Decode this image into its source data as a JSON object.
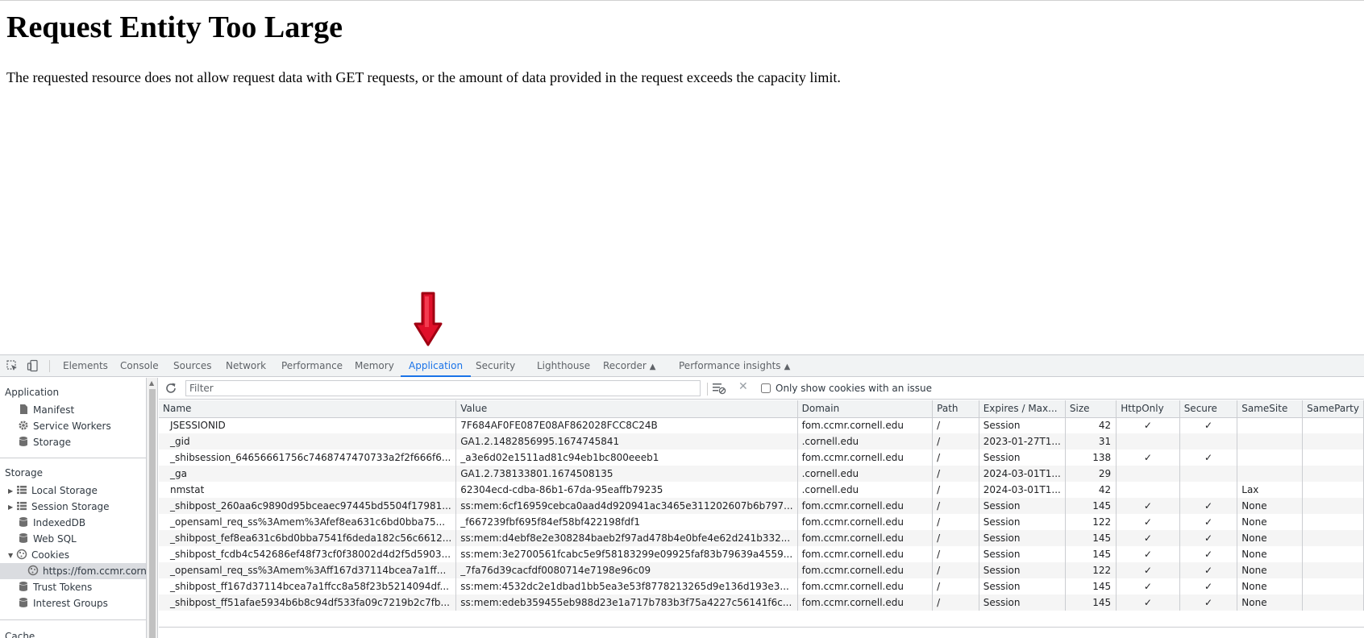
{
  "page": {
    "title": "Request Entity Too Large",
    "message": "The requested resource does not allow request data with GET requests, or the amount of data provided in the request exceeds the capacity limit."
  },
  "devtools": {
    "tabs": [
      {
        "label": "Elements",
        "active": false
      },
      {
        "label": "Console",
        "active": false
      },
      {
        "label": "Sources",
        "active": false
      },
      {
        "label": "Network",
        "active": false
      },
      {
        "label": "Performance",
        "active": false
      },
      {
        "label": "Memory",
        "active": false
      },
      {
        "label": "Application",
        "active": true
      },
      {
        "label": "Security",
        "active": false
      },
      {
        "label": "Lighthouse",
        "active": false
      },
      {
        "label": "Recorder",
        "active": false
      },
      {
        "label": "Performance insights",
        "active": false
      }
    ],
    "sidebar": {
      "application_header": "Application",
      "application_items": [
        {
          "label": "Manifest",
          "icon": "document-icon"
        },
        {
          "label": "Service Workers",
          "icon": "gear-icon"
        },
        {
          "label": "Storage",
          "icon": "database-icon"
        }
      ],
      "storage_header": "Storage",
      "storage_items": [
        {
          "label": "Local Storage",
          "icon": "grid-icon"
        },
        {
          "label": "Session Storage",
          "icon": "grid-icon"
        },
        {
          "label": "IndexedDB",
          "icon": "database-icon"
        },
        {
          "label": "Web SQL",
          "icon": "database-icon"
        },
        {
          "label": "Cookies",
          "icon": "cookie-icon"
        },
        {
          "label": "https://fom.ccmr.cornell.edu",
          "icon": "cookie-icon"
        },
        {
          "label": "Trust Tokens",
          "icon": "database-icon"
        },
        {
          "label": "Interest Groups",
          "icon": "database-icon"
        }
      ],
      "next_header": "Cache"
    },
    "toolbar": {
      "filter_placeholder": "Filter",
      "only_issues_label": "Only show cookies with an issue"
    },
    "table": {
      "columns": [
        "Name",
        "Value",
        "Domain",
        "Path",
        "Expires / Max...",
        "Size",
        "HttpOnly",
        "Secure",
        "SameSite",
        "SameParty"
      ],
      "rows": [
        [
          "JSESSIONID",
          "7F684AF0FE087E08AF862028FCC8C24B",
          "fom.ccmr.cornell.edu",
          "/",
          "Session",
          "42",
          "✓",
          "✓",
          "",
          ""
        ],
        [
          "_gid",
          "GA1.2.1482856995.1674745841",
          ".cornell.edu",
          "/",
          "2023-01-27T1...",
          "31",
          "",
          "",
          "",
          ""
        ],
        [
          "_shibsession_64656661756c7468747470733a2f2f666f6...",
          "_a3e6d02e1511ad81c94eb1bc800eeeb1",
          "fom.ccmr.cornell.edu",
          "/",
          "Session",
          "138",
          "✓",
          "✓",
          "",
          ""
        ],
        [
          "_ga",
          "GA1.2.738133801.1674508135",
          ".cornell.edu",
          "/",
          "2024-03-01T1...",
          "29",
          "",
          "",
          "",
          ""
        ],
        [
          "nmstat",
          "62304ecd-cdba-86b1-67da-95eaffb79235",
          ".cornell.edu",
          "/",
          "2024-03-01T1...",
          "42",
          "",
          "",
          "Lax",
          ""
        ],
        [
          "_shibpost_260aa6c9890d95bceaec97445bd5504f17981...",
          "ss:mem:6cf16959cebca0aad4d920941ac3465e311202607b6b797...",
          "fom.ccmr.cornell.edu",
          "/",
          "Session",
          "145",
          "✓",
          "✓",
          "None",
          ""
        ],
        [
          "_opensaml_req_ss%3Amem%3Afef8ea631c6bd0bba75...",
          "_f667239fbf695f84ef58bf422198fdf1",
          "fom.ccmr.cornell.edu",
          "/",
          "Session",
          "122",
          "✓",
          "✓",
          "None",
          ""
        ],
        [
          "_shibpost_fef8ea631c6bd0bba7541f6deda182c56c6612...",
          "ss:mem:d4ebf8e2e308284baeb2f97ad478b4e0bfe4e62d241b332...",
          "fom.ccmr.cornell.edu",
          "/",
          "Session",
          "145",
          "✓",
          "✓",
          "None",
          ""
        ],
        [
          "_shibpost_fcdb4c542686ef48f73cf0f38002d4d2f5d5903...",
          "ss:mem:3e2700561fcabc5e9f58183299e09925faf83b79639a4559...",
          "fom.ccmr.cornell.edu",
          "/",
          "Session",
          "145",
          "✓",
          "✓",
          "None",
          ""
        ],
        [
          "_opensaml_req_ss%3Amem%3Aff167d37114bcea7a1ff...",
          "_7fa76d39cacfdf0080714e7198e96c09",
          "fom.ccmr.cornell.edu",
          "/",
          "Session",
          "122",
          "✓",
          "✓",
          "None",
          ""
        ],
        [
          "_shibpost_ff167d37114bcea7a1ffcc8a58f23b5214094df...",
          "ss:mem:4532dc2e1dbad1bb5ea3e53f8778213265d9e136d193e3...",
          "fom.ccmr.cornell.edu",
          "/",
          "Session",
          "145",
          "✓",
          "✓",
          "None",
          ""
        ],
        [
          "_shibpost_ff51afae5934b6b8c94df533fa09c7219b2c7fb...",
          "ss:mem:edeb359455eb988d23e1a717b783b3f75a4227c56141f6c...",
          "fom.ccmr.cornell.edu",
          "/",
          "Session",
          "145",
          "✓",
          "✓",
          "None",
          ""
        ]
      ]
    }
  }
}
